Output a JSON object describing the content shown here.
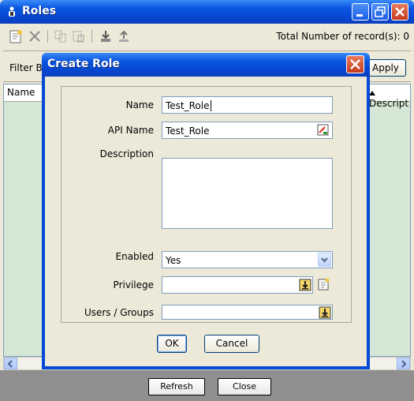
{
  "window": {
    "title": "Roles"
  },
  "toolbar": {
    "total_records": "Total Number of record(s): 0"
  },
  "filter": {
    "label": "Filter B",
    "apply_label": "Apply"
  },
  "table": {
    "columns": [
      "Name",
      "Descript"
    ]
  },
  "footer": {
    "refresh_label": "Refresh",
    "close_label": "Close"
  },
  "dialog": {
    "title": "Create Role",
    "name_label": "Name",
    "name_value": "Test_Role",
    "api_name_label": "API Name",
    "api_name_value": "Test_Role",
    "description_label": "Description",
    "description_value": "",
    "enabled_label": "Enabled",
    "enabled_value": "Yes",
    "privilege_label": "Privilege",
    "privilege_value": "",
    "users_groups_label": "Users / Groups",
    "users_groups_value": "",
    "ok_label": "OK",
    "cancel_label": "Cancel"
  },
  "colors": {
    "title_bar": "#0a55e0",
    "table_background": "#d4e7d4",
    "footer_background": "#8f8f8f"
  }
}
